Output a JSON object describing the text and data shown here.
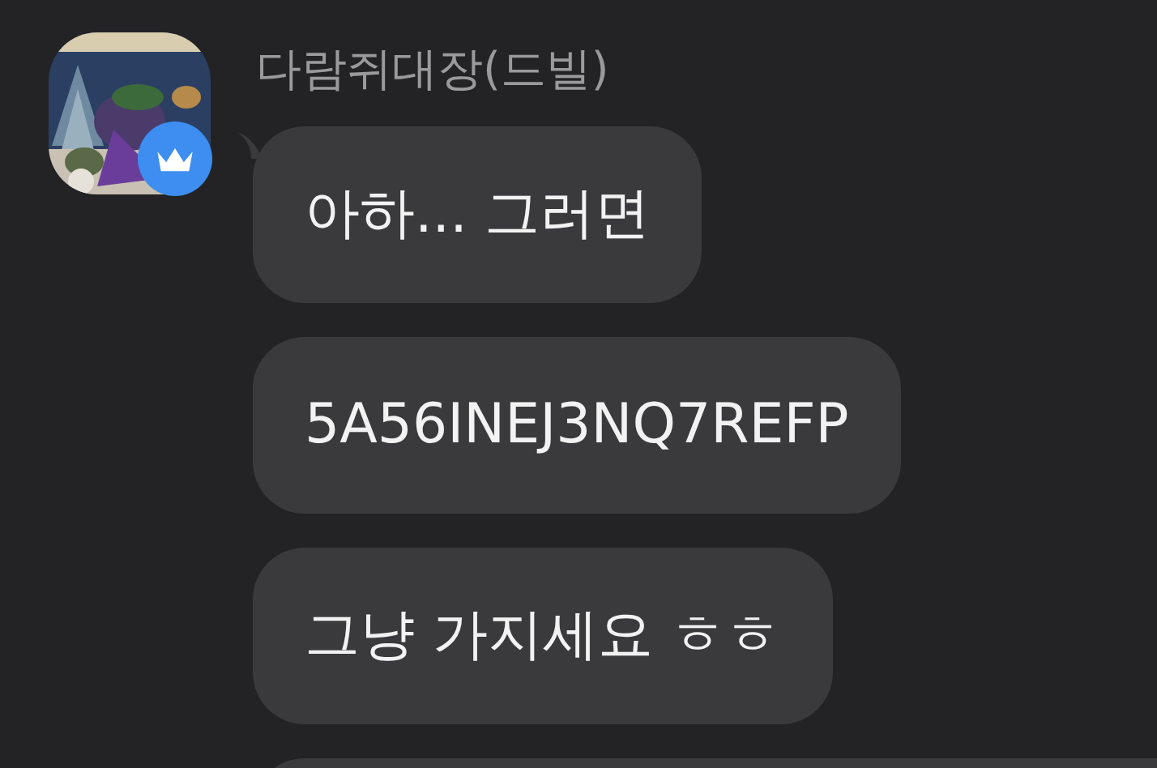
{
  "sender": {
    "name": "다람쥐대장(드빌)",
    "crown_badge": true
  },
  "messages": [
    {
      "kind": "text",
      "text": "아하... 그러면"
    },
    {
      "kind": "text",
      "text": "5A56INEJ3NQ7REFP"
    },
    {
      "kind": "text",
      "text": "그냥 가지세요 ㅎㅎ"
    },
    {
      "kind": "cut"
    }
  ]
}
